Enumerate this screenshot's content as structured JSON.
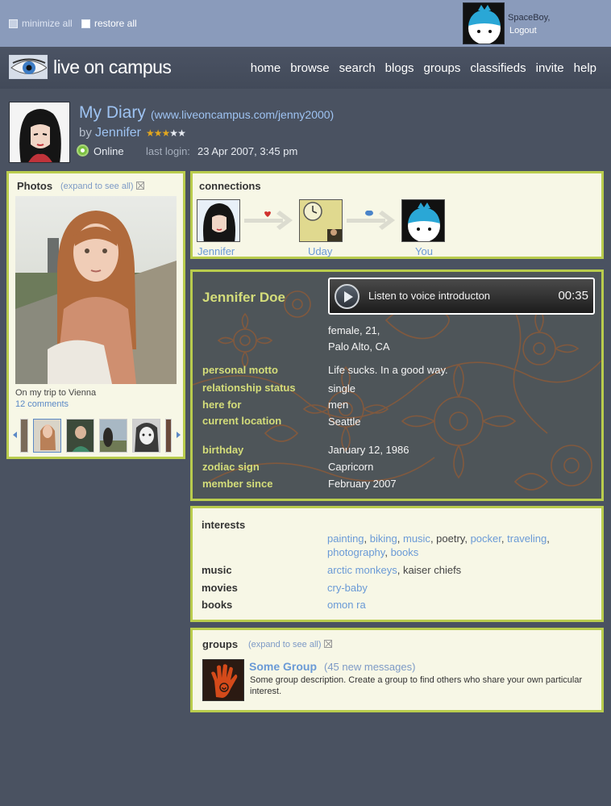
{
  "topbar": {
    "minimize_label": "minimize all",
    "restore_label": "restore all",
    "username": "SpaceBoy,",
    "logout": "Logout"
  },
  "brand": {
    "name": "live on campus"
  },
  "nav": [
    "home",
    "browse",
    "search",
    "blogs",
    "groups",
    "classifieds",
    "invite",
    "help"
  ],
  "profile": {
    "title": "My Diary",
    "url": "(www.liveoncampus.com/jenny2000)",
    "by": "by",
    "name": "Jennifer",
    "rating": 3,
    "rating_max": 5,
    "status": "Online",
    "last_login_label": "last login:",
    "last_login": "23 Apr 2007, 3:45 pm"
  },
  "photos": {
    "title": "Photos",
    "expand": "(expand to see all)",
    "caption": "On my trip to Vienna",
    "comments": "12 comments"
  },
  "connections": {
    "title": "connections",
    "people": [
      "Jennifer",
      "Uday",
      "You"
    ]
  },
  "info": {
    "full_name": "Jennifer Doe",
    "voice_label": "Listen to voice introducton",
    "voice_time": "00:35",
    "basic_line1": "female, 21,",
    "basic_line2": "Palo Alto, CA",
    "fields": [
      {
        "label": "personal motto",
        "value": "Life sucks. In a good way."
      },
      {
        "label": "relationship status",
        "value": "single"
      },
      {
        "label": "here for",
        "value": "men"
      },
      {
        "label": "current location",
        "value": "Seattle"
      },
      {
        "label": "birthday",
        "value": "January 12, 1986"
      },
      {
        "label": "zodiac sign",
        "value": "Capricorn"
      },
      {
        "label": "member since",
        "value": "February 2007"
      }
    ]
  },
  "interests": {
    "title": "interests",
    "items": [
      "painting",
      "biking",
      "music",
      "poetry",
      "pocker",
      "traveling",
      "photography",
      "books"
    ],
    "music_label": "music",
    "music": [
      "arctic monkeys",
      "kaiser chiefs"
    ],
    "movies_label": "movies",
    "movies": "cry-baby",
    "books_label": "books",
    "books": "omon ra"
  },
  "groups": {
    "title": "groups",
    "expand": "(expand to see all)",
    "group_name": "Some Group",
    "group_messages": "(45 new messages)",
    "group_desc": "Some group description. Create a group to find others who share your own particular interest."
  },
  "colors": {
    "background": "#4a5261",
    "panel": "#f7f7e6",
    "panel_border": "#b9cc4d",
    "accent_label": "#d4dd7a",
    "link": "#6a9ad6"
  }
}
